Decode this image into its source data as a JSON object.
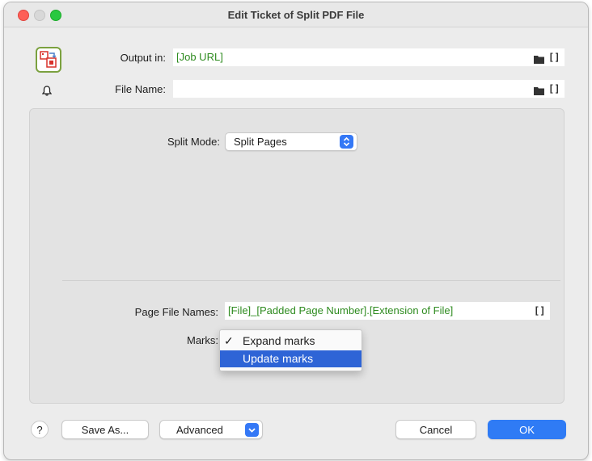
{
  "window": {
    "title": "Edit Ticket of Split PDF File"
  },
  "output": {
    "label": "Output in:",
    "value": "[Job URL]"
  },
  "file_name": {
    "label": "File Name:",
    "value": ""
  },
  "split_mode": {
    "label": "Split Mode:",
    "value": "Split Pages"
  },
  "page_file_names": {
    "label": "Page File Names:",
    "value": "[File]_[Padded Page Number].[Extension of File]"
  },
  "marks": {
    "label": "Marks:",
    "options": [
      {
        "label": "Expand marks",
        "checked": true,
        "check": "✓"
      },
      {
        "label": "Update marks",
        "checked": false,
        "highlighted": true
      }
    ]
  },
  "footer": {
    "help_label": "?",
    "save_as_label": "Save As...",
    "advanced_label": "Advanced",
    "cancel_label": "Cancel",
    "ok_label": "OK"
  },
  "icons": {
    "app": "split-pdf-icon",
    "bell": "bell-icon",
    "folder": "folder-icon",
    "variables": "brackets-icon"
  },
  "colors": {
    "field_text": "#2e8b1f",
    "accent": "#2f7bf5",
    "menu_highlight": "#2e64d6"
  }
}
